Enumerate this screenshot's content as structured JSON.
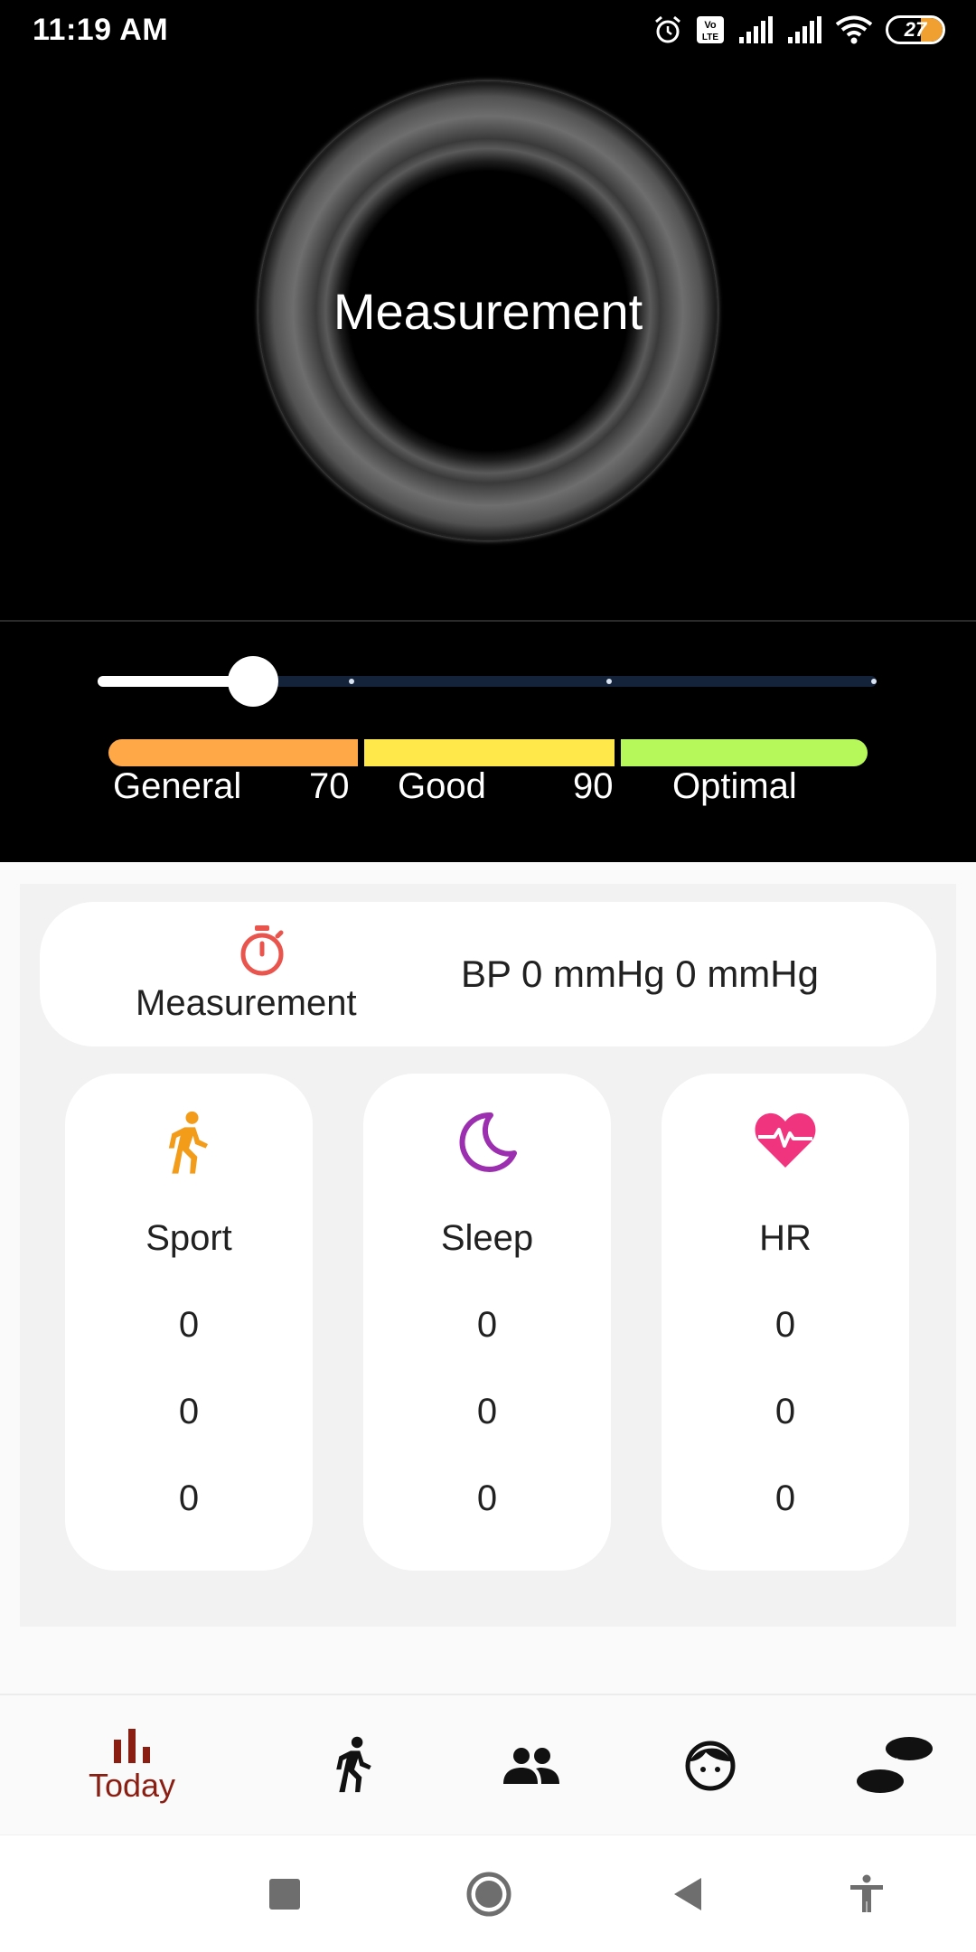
{
  "status_bar": {
    "time": "11:19 AM",
    "battery": "27",
    "icons": [
      "alarm-icon",
      "volte-icon",
      "signal-icon",
      "signal-icon",
      "wifi-icon",
      "battery-icon"
    ]
  },
  "dial": {
    "label": "Measurement"
  },
  "slider": {
    "value_fraction": 0.2,
    "ticks": [
      0.33,
      0.66,
      1.0
    ]
  },
  "ranges": {
    "general": "General",
    "threshold_1": "70",
    "good": "Good",
    "threshold_2": "90",
    "optimal": "Optimal",
    "colors": {
      "general": "#ffa848",
      "good": "#ffe84a",
      "optimal": "#b6f75a"
    }
  },
  "measurement_card": {
    "icon": "timer-icon",
    "label": "Measurement",
    "bp_text": "BP 0 mmHg 0 mmHg"
  },
  "stats": [
    {
      "icon": "walk-icon",
      "title": "Sport",
      "values": [
        "0",
        "0",
        "0"
      ],
      "color": "#f39c1a"
    },
    {
      "icon": "moon-icon",
      "title": "Sleep",
      "values": [
        "0",
        "0",
        "0"
      ],
      "color": "#9c2fb0"
    },
    {
      "icon": "heartbeat-icon",
      "title": "HR",
      "values": [
        "0",
        "0",
        "0"
      ],
      "color": "#f0347e"
    }
  ],
  "bottom_nav": {
    "items": [
      {
        "icon": "bar-chart-icon",
        "label": "Today",
        "active": true
      },
      {
        "icon": "walk-icon",
        "label": ""
      },
      {
        "icon": "people-icon",
        "label": ""
      },
      {
        "icon": "face-icon",
        "label": ""
      },
      {
        "icon": "footprints-icon",
        "label": ""
      }
    ],
    "active_color": "#8b1e12"
  },
  "system_nav": [
    "recents-button",
    "home-button",
    "back-button",
    "accessibility-button"
  ]
}
